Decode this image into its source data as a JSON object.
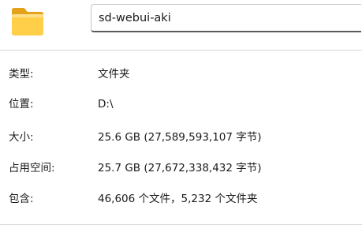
{
  "header": {
    "icon": "folder-icon",
    "folder_color": "#F7C948",
    "name": "sd-webui-aki"
  },
  "properties": [
    {
      "label": "类型:",
      "value": "文件夹"
    },
    {
      "label": "位置:",
      "value": "D:\\"
    },
    {
      "label": "大小:",
      "value": "25.6 GB (27,589,593,107 字节)"
    },
    {
      "label": "占用空间:",
      "value": "25.7 GB (27,672,338,432 字节)"
    },
    {
      "label": "包含:",
      "value": "46,606 个文件，5,232 个文件夹"
    }
  ]
}
